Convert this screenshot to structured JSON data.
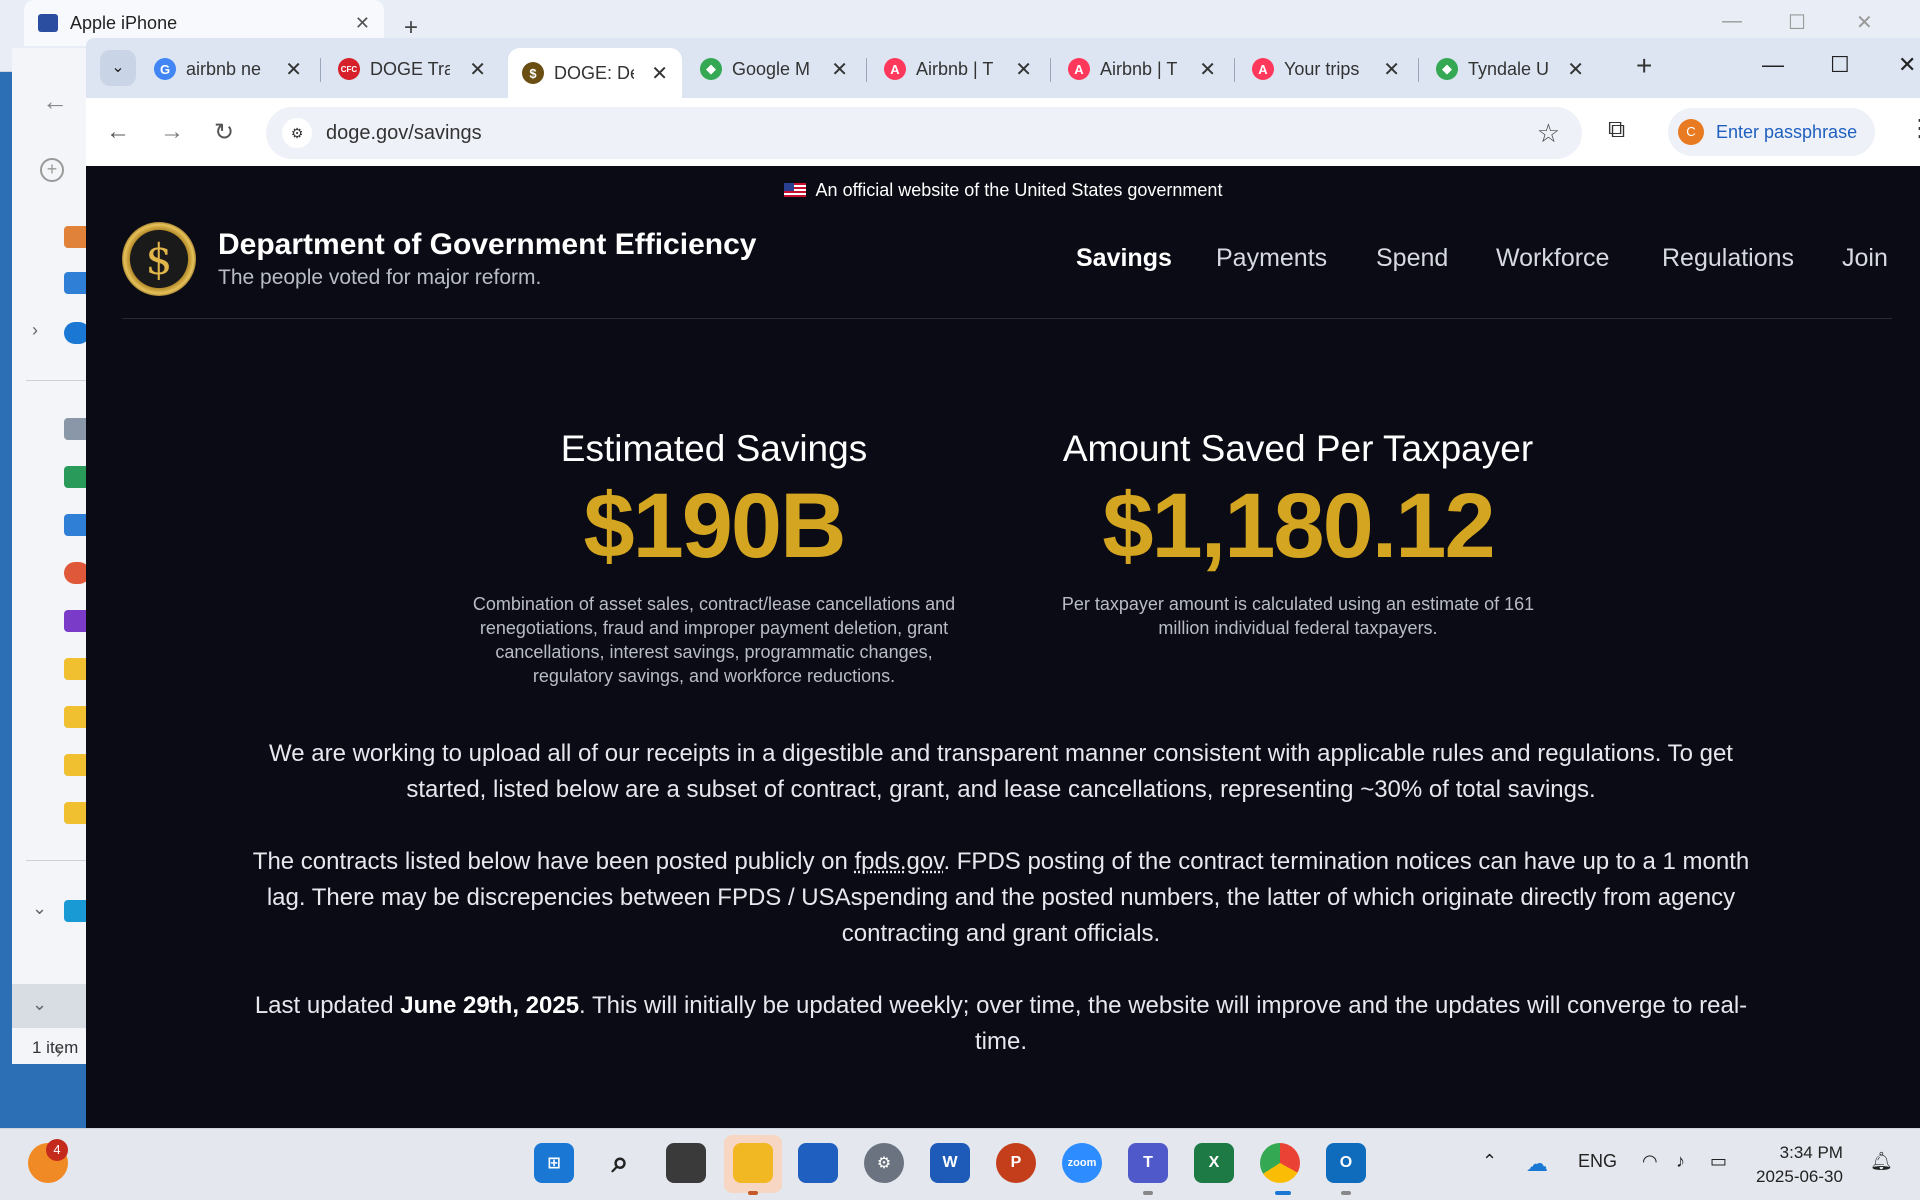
{
  "background_window": {
    "tab_title": "Apple iPhone"
  },
  "explorer": {
    "status": "1 item"
  },
  "browser": {
    "tabs": [
      {
        "label": "airbnb ne",
        "icon": "google-icon",
        "color": "#4285f4",
        "glyph": "G"
      },
      {
        "label": "DOGE Tra",
        "icon": "cfc-icon",
        "color": "#d6202a",
        "glyph": "CFC"
      },
      {
        "label": "DOGE: De",
        "icon": "doge-icon",
        "color": "#6b4e12",
        "glyph": "$"
      },
      {
        "label": "Google M",
        "icon": "maps-icon",
        "color": "#34a853",
        "glyph": "◆"
      },
      {
        "label": "Airbnb | T",
        "icon": "airbnb-icon",
        "color": "#ff385c",
        "glyph": "A"
      },
      {
        "label": "Airbnb | T",
        "icon": "airbnb-icon",
        "color": "#ff385c",
        "glyph": "A"
      },
      {
        "label": "Your trips",
        "icon": "airbnb-icon",
        "color": "#ff385c",
        "glyph": "A"
      },
      {
        "label": "Tyndale U",
        "icon": "maps-icon",
        "color": "#34a853",
        "glyph": "◆"
      }
    ],
    "active_tab_index": 2,
    "url": "doge.gov/savings",
    "profile_label": "Enter passphrase",
    "profile_initial": "C"
  },
  "page": {
    "gov_banner": "An official website of the United States government",
    "brand_title": "Department of Government Efficiency",
    "brand_subtitle": "The people voted for major reform.",
    "nav": [
      "Savings",
      "Payments",
      "Spend",
      "Workforce",
      "Regulations",
      "Join"
    ],
    "active_nav": "Savings",
    "stat1": {
      "label": "Estimated Savings",
      "value": "$190B",
      "desc": "Combination of asset sales, contract/lease cancellations and renegotiations, fraud and improper payment deletion, grant cancellations, interest savings, programmatic changes, regulatory savings, and workforce reductions."
    },
    "stat2": {
      "label": "Amount Saved Per Taxpayer",
      "value": "$1,180.12",
      "desc": "Per taxpayer amount is calculated using an estimate of 161 million individual federal taxpayers."
    },
    "para1": "We are working to upload all of our receipts in a digestible and transparent manner consistent with applicable rules and regulations. To get started, listed below are a subset of contract, grant, and lease cancellations, representing ~30% of total savings.",
    "para2_pre": "The contracts listed below have been posted publicly on ",
    "para2_link": "fpds.gov",
    "para2_post": ". FPDS posting of the contract termination notices can have up to a 1 month lag. There may be discrepencies between FPDS / USAspending and the posted numbers, the latter of which originate directly from agency contracting and grant officials.",
    "para3_pre": "Last updated ",
    "para3_date": "June 29th, 2025",
    "para3_post": ". This will initially be updated weekly; over time, the website will improve and the updates will converge to real-time."
  },
  "taskbar": {
    "notification_count": "4",
    "language": "ENG",
    "time": "3:34 PM",
    "date": "2025-06-30"
  }
}
